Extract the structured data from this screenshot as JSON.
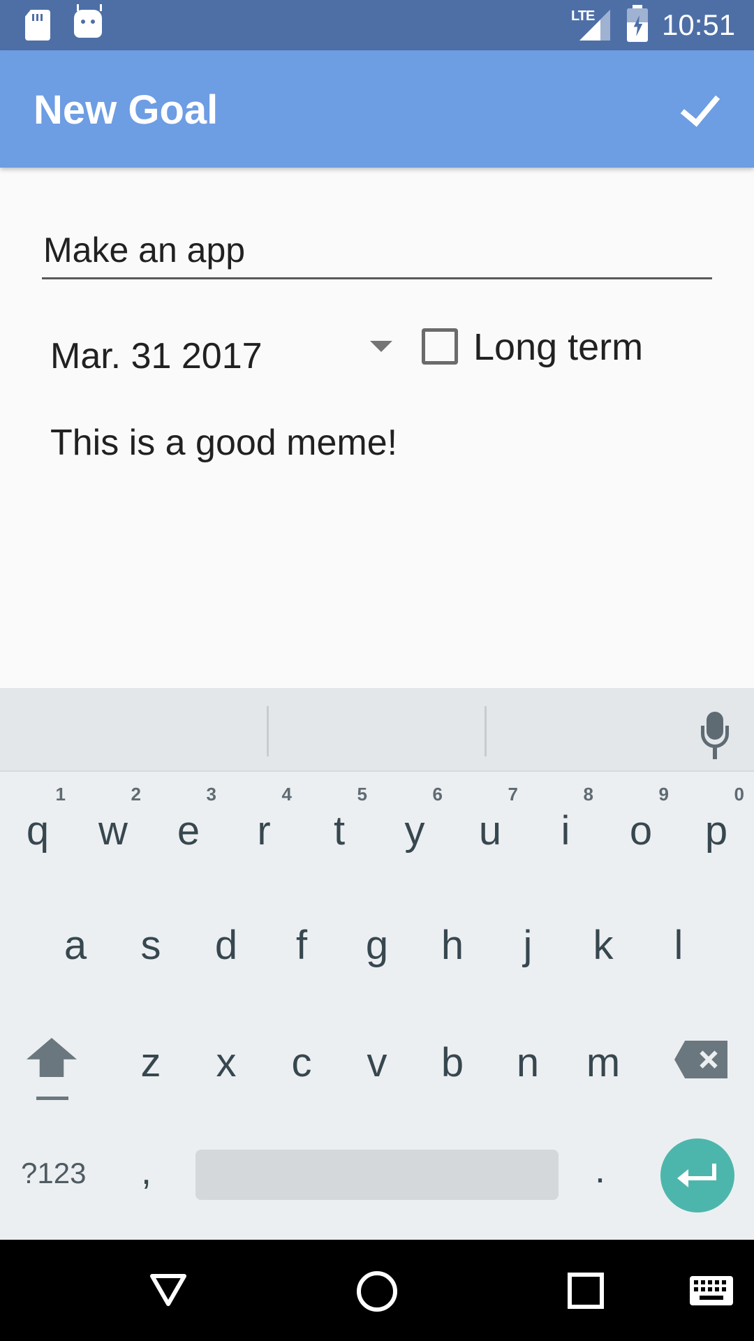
{
  "status_bar": {
    "network_label": "LTE",
    "time": "10:51",
    "icons": [
      "sd-card-icon",
      "android-icon",
      "signal-icon",
      "battery-charging-icon"
    ]
  },
  "app_bar": {
    "title": "New Goal",
    "confirm_icon": "check-icon"
  },
  "form": {
    "goal_name": "Make an app",
    "date": "Mar. 31 2017",
    "long_term_label": "Long term",
    "long_term_checked": false,
    "description": "This is a good meme!"
  },
  "keyboard": {
    "row1": [
      {
        "key": "q",
        "hint": "1"
      },
      {
        "key": "w",
        "hint": "2"
      },
      {
        "key": "e",
        "hint": "3"
      },
      {
        "key": "r",
        "hint": "4"
      },
      {
        "key": "t",
        "hint": "5"
      },
      {
        "key": "y",
        "hint": "6"
      },
      {
        "key": "u",
        "hint": "7"
      },
      {
        "key": "i",
        "hint": "8"
      },
      {
        "key": "o",
        "hint": "9"
      },
      {
        "key": "p",
        "hint": "0"
      }
    ],
    "row2": [
      "a",
      "s",
      "d",
      "f",
      "g",
      "h",
      "j",
      "k",
      "l"
    ],
    "row3": [
      "z",
      "x",
      "c",
      "v",
      "b",
      "n",
      "m"
    ],
    "symbols_label": "?123",
    "comma_label": ",",
    "period_label": ".",
    "accent_color": "#4db6ac"
  },
  "colors": {
    "status_bar": "#4e6fa6",
    "app_bar": "#6d9de3"
  }
}
